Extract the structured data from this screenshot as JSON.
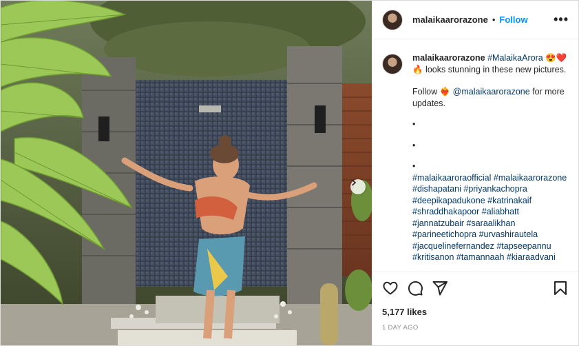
{
  "post": {
    "username": "malaikaarorazone",
    "header_dot": "•",
    "follow_label": "Follow",
    "more_label": "•••"
  },
  "caption": {
    "username": "malaikaarorazone",
    "hashtag_1": "#MalaikaArora",
    "emoji_1": "😍❤️",
    "emoji_fire": "🔥",
    "text_1": " looks stunning in these new pictures.",
    "follow_prefix": "Follow ",
    "emoji_heart": "❤️‍🔥",
    "mention": "@malaikaarorazone",
    "follow_suffix": " for more updates.",
    "bullets": [
      "•",
      "•",
      "•"
    ],
    "hashtags": [
      "#malaikaaroraofficial #malaikaarorazone",
      "#dishapatani #priyankachopra",
      "#deepikapadukone #katrinakaif",
      "#shraddhakapoor #aliabhatt",
      "#jannatzubair #saraalikhan",
      "#parineetichopra #urvashirautela",
      "#jacquelinefernandez #tapseepannu",
      "#kritisanon #tamannaah #kiaraadvani"
    ]
  },
  "actions": {
    "like_icon": "heart-icon",
    "comment_icon": "comment-icon",
    "share_icon": "paper-plane-icon",
    "save_icon": "bookmark-icon"
  },
  "stats": {
    "likes": "5,177 likes",
    "date": "1 DAY AGO"
  },
  "media": {
    "next_icon": "chevron-right-icon"
  }
}
